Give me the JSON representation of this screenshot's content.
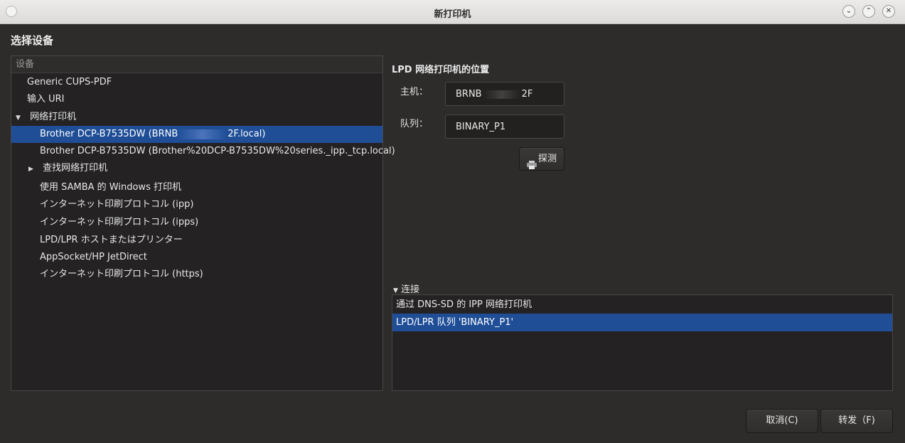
{
  "window": {
    "title": "新打印机"
  },
  "heading": "选择设备",
  "device_tree": {
    "header": "设备",
    "items": [
      {
        "label": "Generic CUPS-PDF"
      },
      {
        "label": "输入 URI"
      },
      {
        "label": "网络打印机"
      },
      {
        "label_prefix": "Brother DCP-B7535DW (BRNB",
        "label_suffix": "2F.local)"
      },
      {
        "label": "Brother DCP-B7535DW (Brother%20DCP-B7535DW%20series._ipp._tcp.local)"
      },
      {
        "label": "查找网络打印机"
      },
      {
        "label": "使用 SAMBA 的 Windows 打印机"
      },
      {
        "label": "インターネット印刷プロトコル (ipp)"
      },
      {
        "label": "インターネット印刷プロトコル (ipps)"
      },
      {
        "label": "LPD/LPR ホストまたはプリンター"
      },
      {
        "label": "AppSocket/HP JetDirect"
      },
      {
        "label": "インターネット印刷プロトコル (https)"
      }
    ]
  },
  "lpd": {
    "section_title": "LPD 网络打印机的位置",
    "host_label": "主机：",
    "host_prefix": "BRNB",
    "host_suffix": "2F",
    "queue_label": "队列：",
    "queue_value": "BINARY_P1",
    "probe_label": "探测"
  },
  "connection": {
    "expander_label": "连接",
    "items": [
      {
        "label": "通过 DNS-SD 的 IPP 网络打印机"
      },
      {
        "label": "LPD/LPR 队列 'BINARY_P1'"
      }
    ]
  },
  "buttons": {
    "cancel": "取消(C)",
    "forward": "转发（F)"
  }
}
